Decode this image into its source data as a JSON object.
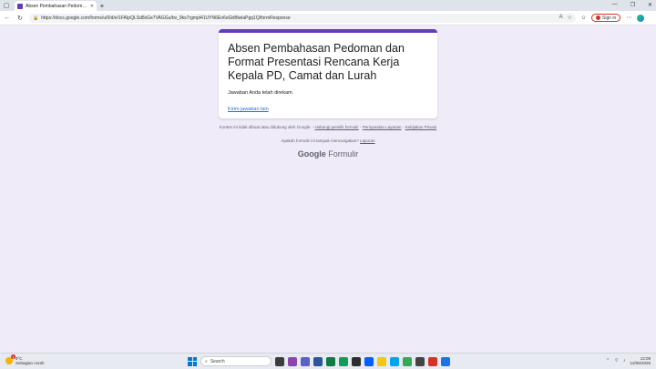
{
  "browser": {
    "tab_title": "Absen Pembahasan Pedoman dan",
    "url": "https://docs.google.com/forms/u/0/d/e/1FAIpQLSd8xGe7VAGGu/bv_9ks7rgmpl41UYN6Eo6oGbBlwlaPgq1Q/formResponse",
    "sign_in_label": "Sign in"
  },
  "form": {
    "title": "Absen  Pembahasan Pedoman dan Format Presentasi Rencana Kerja Kepala PD, Camat dan Lurah",
    "confirmation": "Jawaban Anda telah direkam.",
    "another_response_link": "Kirim jawaban lain"
  },
  "footer": {
    "disclaimer": "Konten ini tidak dibuat atau didukung oleh Google. -",
    "contact_owner": "Hubungi pemilik formulir",
    "sep1": "-",
    "terms": "Persyaratan Layanan",
    "sep2": "-",
    "privacy": "Kebijakan Privasi",
    "suspicious": "Apakah formulir ini tampak mencurigakan?",
    "report": "Laporan",
    "brand_google": "Google",
    "brand_forms": "Formulir"
  },
  "taskbar": {
    "weather_temp": "9°C",
    "weather_desc": "Sebagian cerah",
    "weather_badge": "1",
    "search_label": "Search",
    "time": "13:09",
    "date": "12/06/2025"
  },
  "colors": {
    "accent": "#673ab7",
    "page_bg": "#f0ebf8",
    "link": "#1a73e8"
  }
}
